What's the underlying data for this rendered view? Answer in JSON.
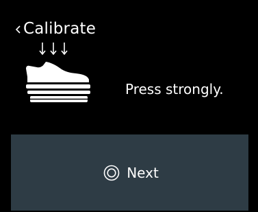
{
  "header": {
    "back_icon": "chevron-left-icon",
    "title": "Calibrate"
  },
  "illustration": {
    "icon": "shoe-on-scale-icon",
    "press_arrows_icon": "down-arrows-icon"
  },
  "instruction": {
    "text": "Press strongly."
  },
  "next_button": {
    "icon": "ring-icon",
    "label": "Next"
  },
  "colors": {
    "background": "#000000",
    "panel": "#2e3c45",
    "text": "#ffffff"
  }
}
